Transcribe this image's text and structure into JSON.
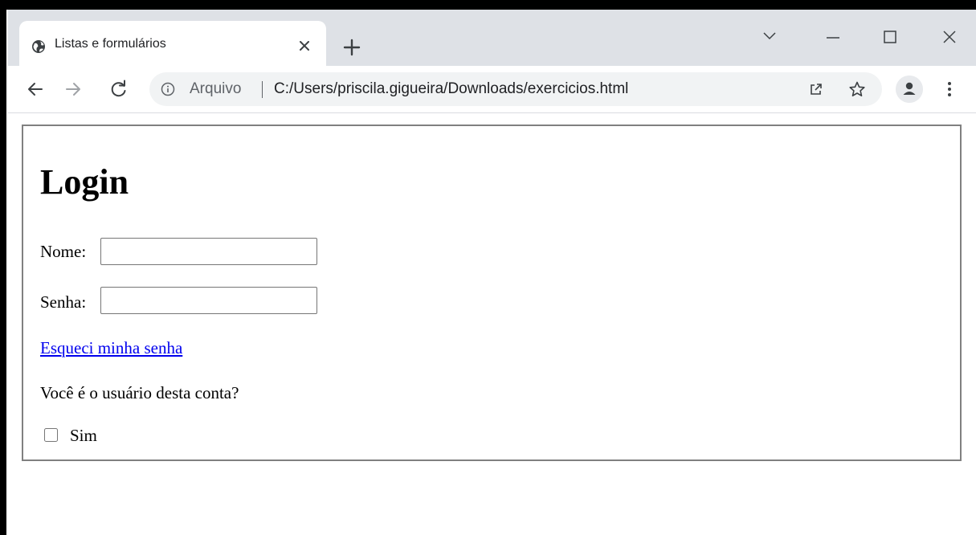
{
  "browser": {
    "tab_title": "Listas e formulários",
    "scheme_label": "Arquivo",
    "url": "C:/Users/priscila.gigueira/Downloads/exercicios.html",
    "icons": [
      "globe-icon",
      "close-icon",
      "plus-icon",
      "chevron-down-icon",
      "minimize-icon",
      "maximize-icon",
      "window-close-icon",
      "back-arrow-icon",
      "forward-arrow-icon",
      "reload-icon",
      "info-icon",
      "share-icon",
      "star-icon",
      "profile-icon",
      "kebab-menu-icon"
    ]
  },
  "page": {
    "heading": "Login",
    "name_label": "Nome:",
    "name_value": "",
    "password_label": "Senha:",
    "password_value": "",
    "forgot_link": "Esqueci minha senha",
    "question": "Você é o usuário desta conta?",
    "checkbox_label": "Sim",
    "checkbox_checked": false
  }
}
